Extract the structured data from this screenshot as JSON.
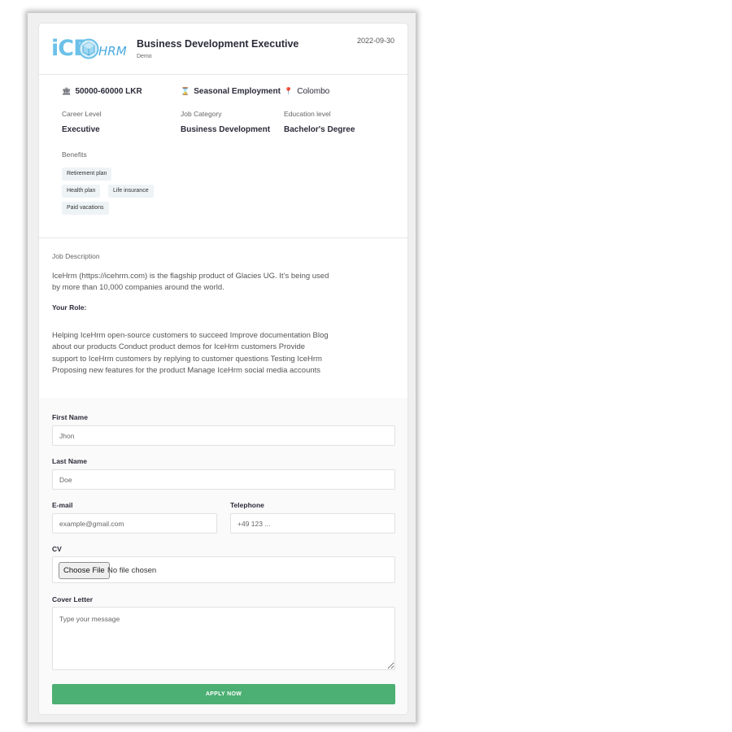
{
  "header": {
    "logo_ice": "iCE",
    "logo_hrm": "HRM",
    "job_title": "Business Development Executive",
    "company": "Demo",
    "date": "2022-09-30"
  },
  "meta": {
    "salary": "50000-60000 LKR",
    "employment_type": "Seasonal Employment",
    "location": "Colombo",
    "salary_icon": "bank-icon",
    "employment_icon": "hourglass-icon",
    "location_icon": "map-pin-icon",
    "career_level_label": "Career Level",
    "career_level": "Executive",
    "job_category_label": "Job Category",
    "job_category": "Business Development",
    "education_label": "Education level",
    "education": "Bachelor's Degree",
    "benefits_label": "Benefits",
    "benefits": [
      "Retirement plan",
      "Health plan",
      "Life insurance",
      "Paid vacations"
    ]
  },
  "description": {
    "label": "Job Description",
    "intro_line1": "IceHrm (https://icehrm.com) is the flagship product of Glacies UG. It’s being used",
    "intro_line2": "by more than 10,000 companies around the world.",
    "role_heading": "Your Role:",
    "role_lines": [
      "Helping IceHrm open-source customers to succeed Improve documentation Blog",
      "about our products Conduct product demos for IceHrm customers Provide",
      "support to IceHrm customers by replying to customer questions Testing IceHrm",
      "Proposing new features for the product Manage IceHrm social media accounts"
    ]
  },
  "form": {
    "first_name_label": "First Name",
    "first_name_placeholder": "Jhon",
    "last_name_label": "Last Name",
    "last_name_placeholder": "Doe",
    "email_label": "E-mail",
    "email_placeholder": "example@gmail.com",
    "telephone_label": "Telephone",
    "telephone_placeholder": "+49 123 ...",
    "cv_label": "CV",
    "choose_file_label": "Choose File",
    "file_status": "No file chosen",
    "cover_letter_label": "Cover Letter",
    "cover_letter_placeholder": "Type your message",
    "apply_label": "APPLY NOW"
  },
  "colors": {
    "accent_green": "#4caf73",
    "logo_blue": "#6cc1e8",
    "pin_red": "#e0413a"
  }
}
